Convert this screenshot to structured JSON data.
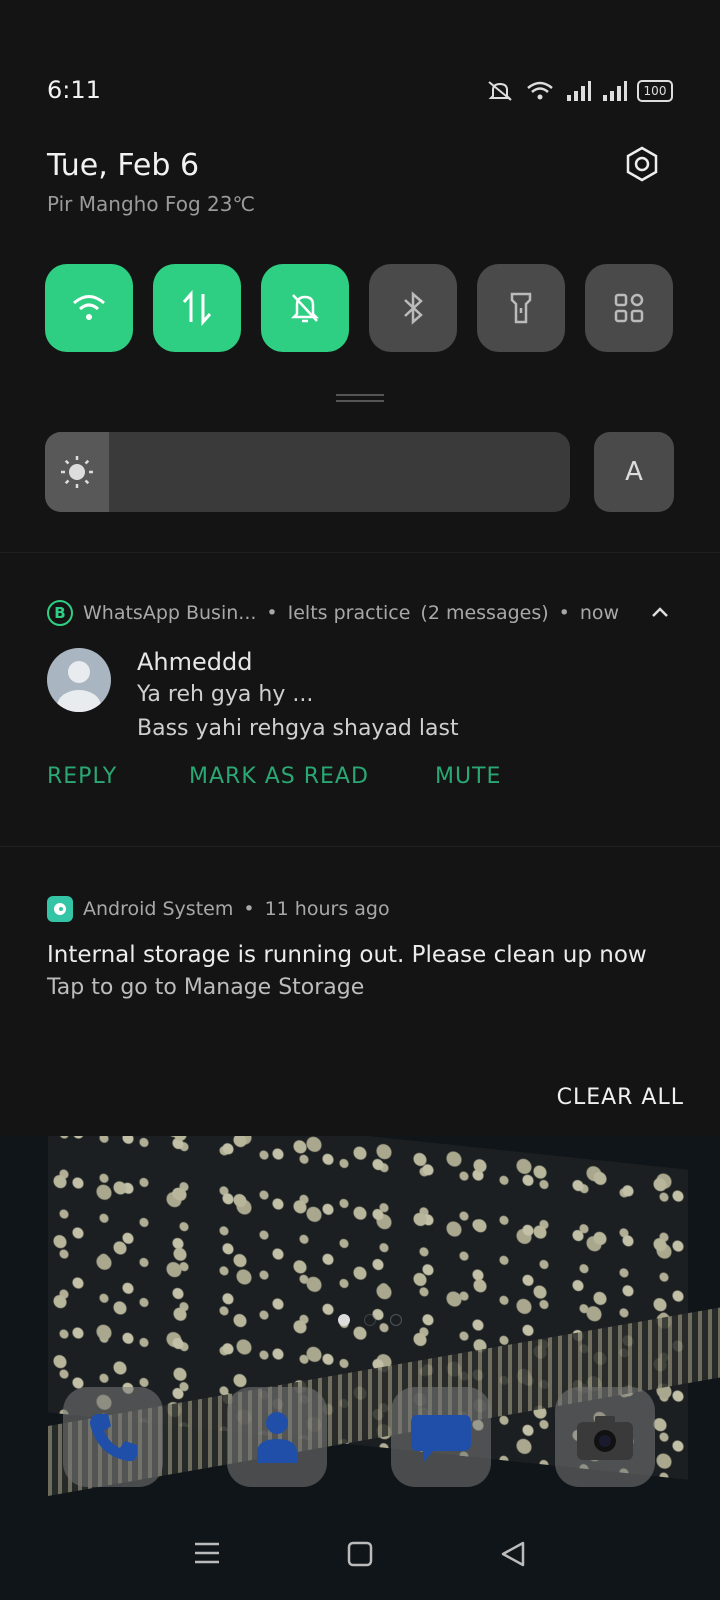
{
  "status_bar": {
    "time": "6:11",
    "battery": "100"
  },
  "header": {
    "date": "Tue, Feb 6",
    "weather": "Pir Mangho Fog 23℃"
  },
  "quick_settings": [
    {
      "name": "wifi-icon",
      "state": "on"
    },
    {
      "name": "mobile-data-icon",
      "state": "on"
    },
    {
      "name": "silent-icon",
      "state": "on"
    },
    {
      "name": "bluetooth-icon",
      "state": "off"
    },
    {
      "name": "flashlight-icon",
      "state": "off"
    },
    {
      "name": "more-tiles-icon",
      "state": "off"
    }
  ],
  "brightness": {
    "level": 0.12,
    "auto_label": "A"
  },
  "notifications": {
    "whatsapp": {
      "app": "WhatsApp Busin...",
      "conversation": "Ielts practice",
      "count": "(2 messages)",
      "time": "now",
      "sender": "Ahmeddd",
      "messages": [
        "Ya reh gya hy ...",
        "Bass yahi rehgya shayad last"
      ],
      "actions": [
        "REPLY",
        "MARK AS READ",
        "MUTE"
      ]
    },
    "system": {
      "app": "Android System",
      "time": "11 hours ago",
      "title": "Internal storage is running out. Please clean up now",
      "subtitle": "Tap to go to Manage Storage"
    },
    "clear_all": "CLEAR ALL"
  },
  "separator": "•",
  "colors": {
    "accent": "#2ecf82",
    "action": "#2aa873",
    "background": "#141414"
  },
  "home": {
    "dock": [
      "phone-icon",
      "contacts-icon",
      "messages-icon",
      "camera-icon"
    ],
    "page_count": 3,
    "active_page": 1
  }
}
